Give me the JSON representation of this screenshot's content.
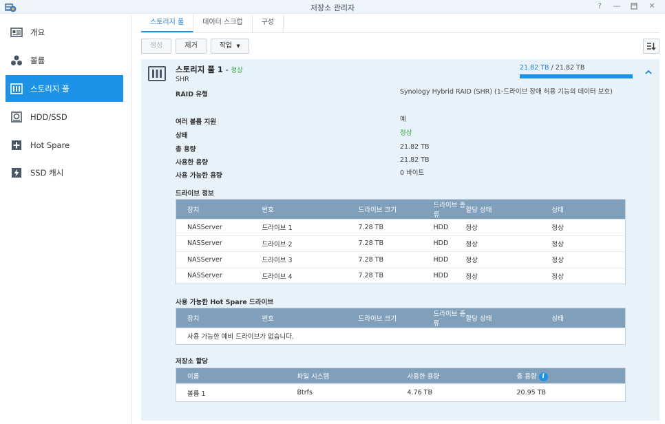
{
  "window": {
    "title": "저장소 관리자"
  },
  "sidebar": {
    "items": [
      {
        "label": "개요",
        "icon": "overview-icon",
        "active": false
      },
      {
        "label": "볼륨",
        "icon": "volume-icon",
        "active": false
      },
      {
        "label": "스토리지 풀",
        "icon": "storage-pool-icon",
        "active": true
      },
      {
        "label": "HDD/SSD",
        "icon": "hdd-icon",
        "active": false
      },
      {
        "label": "Hot Spare",
        "icon": "hot-spare-icon",
        "active": false
      },
      {
        "label": "SSD 캐시",
        "icon": "ssd-cache-icon",
        "active": false
      }
    ]
  },
  "tabs": [
    {
      "label": "스토리지 풀",
      "active": true
    },
    {
      "label": "데이터 스크럽",
      "active": false
    },
    {
      "label": "구성",
      "active": false
    }
  ],
  "toolbar": {
    "create": "생성",
    "remove": "제거",
    "action": "작업"
  },
  "pool": {
    "name": "스토리지 풀 1",
    "status": "정상",
    "type": "SHR",
    "capacity_used": "21.82 TB",
    "capacity_total": "21.82 TB",
    "usage_fraction": 1.0,
    "properties": [
      {
        "label": "RAID 유형",
        "value": "Synology Hybrid RAID (SHR) (1-드라이브 장애 허용 기능의 데이터 보호)",
        "green": false
      },
      {
        "label": "여러 볼륨 지원",
        "value": "예",
        "green": false
      },
      {
        "label": "상태",
        "value": "정상",
        "green": true
      },
      {
        "label": "총 용량",
        "value": "21.82 TB",
        "green": false
      },
      {
        "label": "사용한 용량",
        "value": "21.82 TB",
        "green": false
      },
      {
        "label": "사용 가능한 용량",
        "value": "0 바이트",
        "green": false
      }
    ]
  },
  "drive_info": {
    "title": "드라이브 정보",
    "headers": [
      "장치",
      "번호",
      "드라이브 크기",
      "드라이브 종류",
      "할당 상태",
      "상태"
    ],
    "rows": [
      [
        "NASServer",
        "드라이브 1",
        "7.28 TB",
        "HDD",
        "정상",
        "정상"
      ],
      [
        "NASServer",
        "드라이브 2",
        "7.28 TB",
        "HDD",
        "정상",
        "정상"
      ],
      [
        "NASServer",
        "드라이브 3",
        "7.28 TB",
        "HDD",
        "정상",
        "정상"
      ],
      [
        "NASServer",
        "드라이브 4",
        "7.28 TB",
        "HDD",
        "정상",
        "정상"
      ]
    ]
  },
  "hot_spare": {
    "title_prefix": "사용 가능한 ",
    "title_bold": "Hot Spare",
    "title_suffix": " 드라이브",
    "headers": [
      "장치",
      "번호",
      "드라이브 크기",
      "드라이브 종류",
      "할당 상태",
      "상태"
    ],
    "empty_text": "사용 가능한 예비 드라이브가 없습니다."
  },
  "allocation": {
    "title": "저장소 할당",
    "headers": [
      "이름",
      "파일 시스템",
      "사용한 용량",
      "총 용량"
    ],
    "rows": [
      [
        "볼륨 1",
        "Btrfs",
        "4.76 TB",
        "20.95 TB"
      ]
    ]
  },
  "colors": {
    "accent": "#1e92e6",
    "ok": "#3aa53a",
    "table_header": "#7f9fba",
    "panel": "#e8f2fb"
  }
}
